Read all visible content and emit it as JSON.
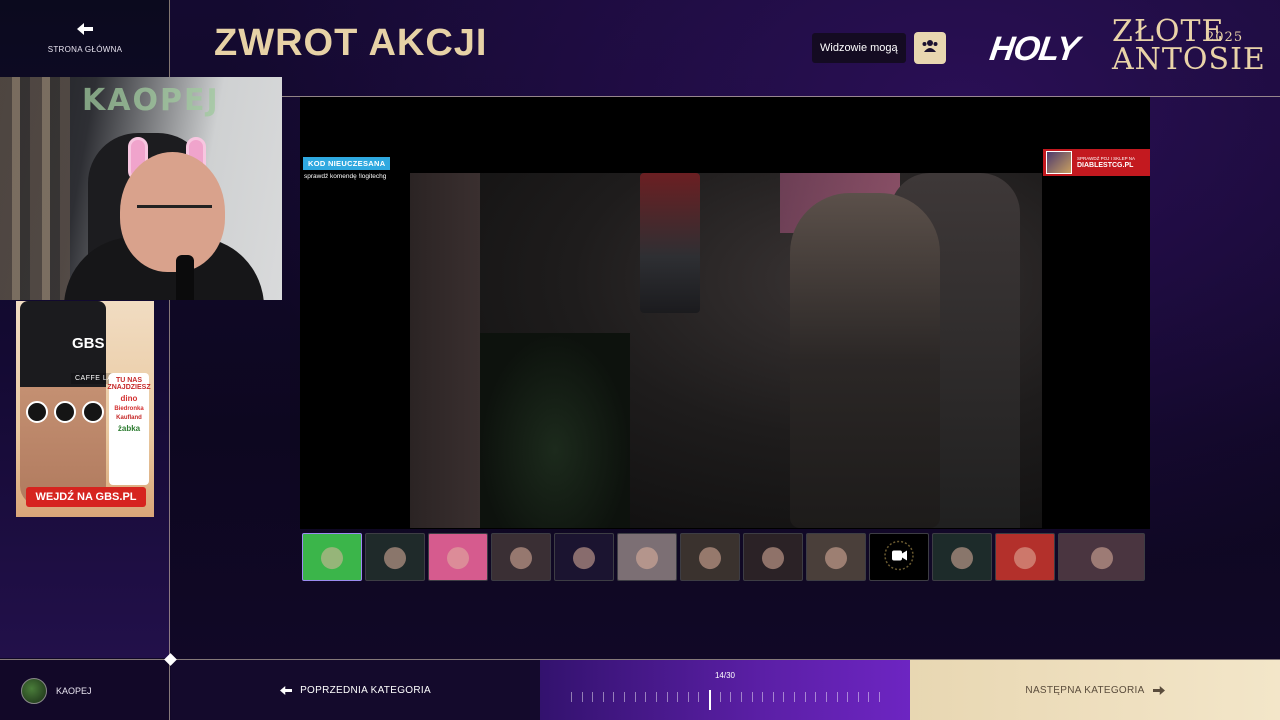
{
  "nav": {
    "home_label": "STRONA GŁÓWNA",
    "home_icon": "arrow-left-icon"
  },
  "header": {
    "title": "ZWROT AKCJI",
    "viewers_label": "Widzowie mogą",
    "viewers_icon": "users-icon",
    "brand": "HOLY",
    "event_line1": "ZŁOTE",
    "event_line2": "ANTOSIE",
    "event_year": "2025"
  },
  "webcam": {
    "sign": "KAOPEJ"
  },
  "ad": {
    "brand": "GBS",
    "product": "CAFFE LATTE",
    "stores_heading": "TU NAS ZNAJDZIESZ",
    "stores": [
      "dino",
      "Biedronka",
      "Kaufland",
      "żabka"
    ],
    "cta": "WEJDŹ NA GBS.PL"
  },
  "stream": {
    "badge": "KOD NIEUCZESANA",
    "badge_sub": "sprawdź komendę !logitechg",
    "sponsor_small": "SPRAWDŹ POJ I SKLEP NA",
    "sponsor_main": "DIABLESTCG.PL",
    "badge_color": "#2fa9e0",
    "sponsor_color": "#c3191f"
  },
  "participants": [
    {
      "name": "participant-1",
      "bg": "#3bb54a",
      "active": true
    },
    {
      "name": "participant-2",
      "bg": "#1f2a2a"
    },
    {
      "name": "participant-3",
      "bg": "#d65b8e"
    },
    {
      "name": "participant-4",
      "bg": "#3a2f34"
    },
    {
      "name": "participant-5",
      "bg": "#1b1430"
    },
    {
      "name": "participant-6",
      "bg": "#7c6f74"
    },
    {
      "name": "participant-7",
      "bg": "#3a322e"
    },
    {
      "name": "participant-8",
      "bg": "#2b2226"
    },
    {
      "name": "participant-9",
      "bg": "#4a3f3a"
    },
    {
      "name": "participant-10",
      "bg": "#000000",
      "icon": "video-camera-icon"
    },
    {
      "name": "participant-11",
      "bg": "#1d2b2a"
    },
    {
      "name": "participant-12",
      "bg": "#b3302b"
    },
    {
      "name": "participant-13",
      "bg": "#4a3540",
      "wide": true
    }
  ],
  "footer": {
    "user_name": "KAOPEJ",
    "prev_label": "POPRZEDNIA KATEGORIA",
    "progress_text": "14/30",
    "progress_current": 14,
    "progress_total": 30,
    "next_label": "NASTĘPNA KATEGORIA"
  },
  "colors": {
    "gold": "#e7d2a6",
    "purple": "#5b1fa6",
    "cream": "#efe0c0"
  }
}
